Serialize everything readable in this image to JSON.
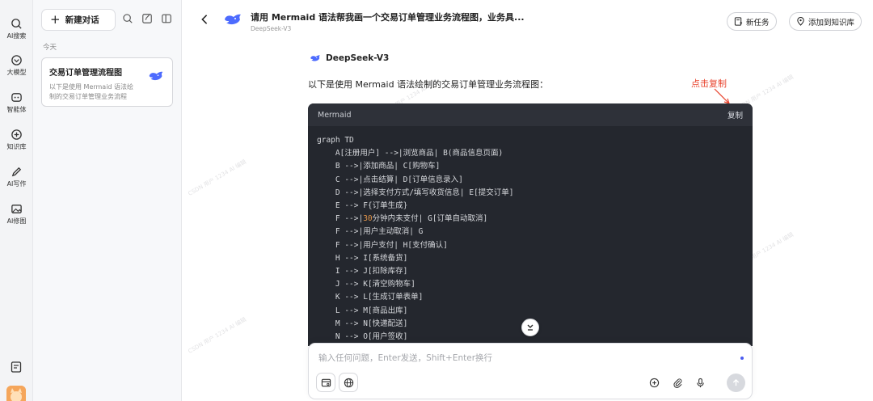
{
  "rail": {
    "items": [
      {
        "label": "AI搜索",
        "icon": "search-icon"
      },
      {
        "label": "大模型",
        "icon": "model-icon"
      },
      {
        "label": "智能体",
        "icon": "agent-icon"
      },
      {
        "label": "知识库",
        "icon": "knowledge-icon"
      },
      {
        "label": "AI写作",
        "icon": "pen-icon"
      },
      {
        "label": "AI修图",
        "icon": "image-icon"
      }
    ]
  },
  "panel": {
    "new_chat_label": "新建对话",
    "section_label": "今天",
    "conversation": {
      "title": "交易订单管理流程图",
      "desc": "以下是使用 Mermaid 语法绘制的交易订单管理业务流程"
    }
  },
  "header": {
    "title": "请用 Mermaid 语法帮我画一个交易订单管理业务流程图，业务具...",
    "subtitle": "DeepSeek-V3",
    "new_task_label": "新任务",
    "add_kb_label": "添加到知识库"
  },
  "message": {
    "model_name": "DeepSeek-V3",
    "intro": "以下是使用 Mermaid 语法绘制的交易订单管理业务流程图：",
    "annotation": "点击复制"
  },
  "code": {
    "lang": "Mermaid",
    "copy_label": "复制",
    "lines": [
      "graph TD",
      "    A[注册用户] -->|浏览商品| B(商品信息页面)",
      "    B -->|添加商品| C[购物车]",
      "    C -->|点击结算| D[订单信息录入]",
      "    D -->|选择支付方式/填写收货信息| E[提交订单]",
      "    E --> F{订单生成}",
      "    F -->|30分钟内未支付| G[订单自动取消]",
      "    F -->|用户主动取消| G",
      "    F -->|用户支付| H[支付确认]",
      "    H --> I[系统备货]",
      "    I --> J[扣除库存]",
      "    J --> K[清空购物车]",
      "    K --> L[生成订单表单]",
      "    L --> M[商品出库]",
      "    M --> N[快递配送]",
      "    N --> O[用户签收]"
    ]
  },
  "input": {
    "placeholder": "输入任何问题，Enter发送，Shift+Enter换行",
    "value": ""
  },
  "colors": {
    "accent": "#4a5bf0",
    "annotation": "#e8432d",
    "code_bg": "#24272e"
  }
}
